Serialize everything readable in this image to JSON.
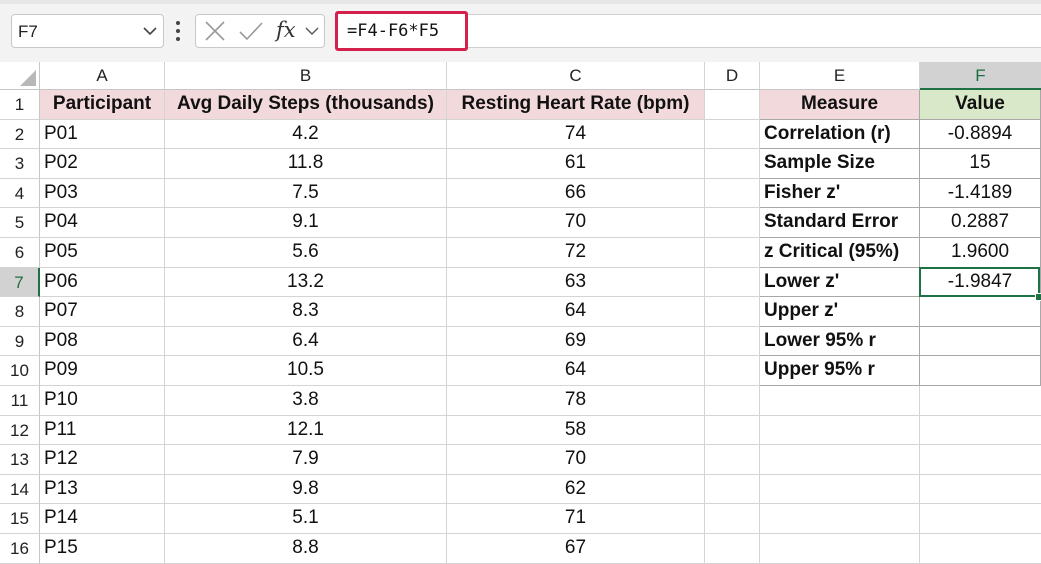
{
  "formula_bar": {
    "name_box": "F7",
    "fx_label": "fx",
    "formula": "=F4-F6*F5"
  },
  "columns": [
    "A",
    "B",
    "C",
    "D",
    "E",
    "F"
  ],
  "rows": [
    "1",
    "2",
    "3",
    "4",
    "5",
    "6",
    "7",
    "8",
    "9",
    "10",
    "11",
    "12",
    "13",
    "14",
    "15",
    "16"
  ],
  "main_table": {
    "headers": [
      "Participant",
      "Avg Daily Steps (thousands)",
      "Resting Heart Rate (bpm)"
    ],
    "rows": [
      [
        "P01",
        "4.2",
        "74"
      ],
      [
        "P02",
        "11.8",
        "61"
      ],
      [
        "P03",
        "7.5",
        "66"
      ],
      [
        "P04",
        "9.1",
        "70"
      ],
      [
        "P05",
        "5.6",
        "72"
      ],
      [
        "P06",
        "13.2",
        "63"
      ],
      [
        "P07",
        "8.3",
        "64"
      ],
      [
        "P08",
        "6.4",
        "69"
      ],
      [
        "P09",
        "10.5",
        "64"
      ],
      [
        "P10",
        "3.8",
        "78"
      ],
      [
        "P11",
        "12.1",
        "58"
      ],
      [
        "P12",
        "7.9",
        "70"
      ],
      [
        "P13",
        "9.8",
        "62"
      ],
      [
        "P14",
        "5.1",
        "71"
      ],
      [
        "P15",
        "8.8",
        "67"
      ]
    ]
  },
  "stats_table": {
    "headers": [
      "Measure",
      "Value"
    ],
    "rows": [
      [
        "Correlation (r)",
        "-0.8894"
      ],
      [
        "Sample Size",
        "15"
      ],
      [
        "Fisher z'",
        "-1.4189"
      ],
      [
        "Standard Error",
        "0.2887"
      ],
      [
        "z Critical (95%)",
        "1.9600"
      ],
      [
        "Lower z'",
        "-1.9847"
      ],
      [
        "Upper z'",
        ""
      ],
      [
        "Lower 95% r",
        ""
      ],
      [
        "Upper 95% r",
        ""
      ]
    ]
  },
  "active_cell": "F7",
  "colors": {
    "accent_green": "#1e7145",
    "formula_highlight": "#d6204c",
    "header_pink": "#f2d9dc",
    "header_green": "#d9e8c8"
  }
}
